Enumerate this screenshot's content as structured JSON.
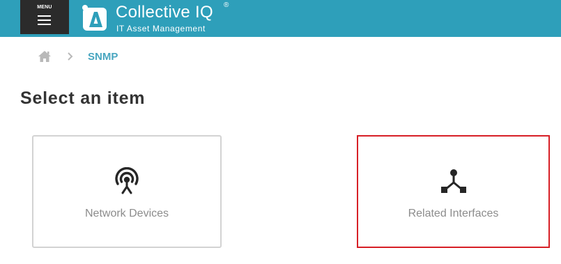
{
  "header": {
    "menu_label": "MENU",
    "menu_icon": "hamburger-icon",
    "logo": {
      "name": "Collective IQ",
      "registered": "®",
      "tagline": "IT Asset Management",
      "icon": "collective-iq-logo-icon"
    },
    "bar_color": "#2e9fba"
  },
  "breadcrumb": {
    "home_icon": "home-icon",
    "separator_icon": "chevron-right-icon",
    "current": "SNMP",
    "current_color": "#49a6c0"
  },
  "main": {
    "title": "Select an item",
    "items": [
      {
        "label": "Network Devices",
        "icon": "antenna-icon",
        "selected": false
      },
      {
        "label": "Related Interfaces",
        "icon": "network-node-icon",
        "selected": true
      }
    ],
    "selection_color": "#d71f26"
  }
}
